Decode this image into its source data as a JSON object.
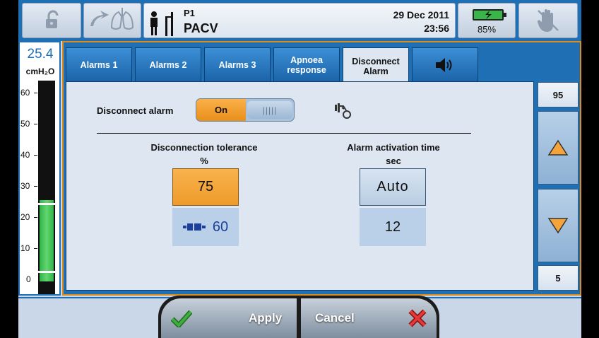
{
  "header": {
    "patient_id": "P1",
    "mode": "PACV",
    "date": "29 Dec 2011",
    "time": "23:56",
    "battery_percent": "85%",
    "battery_level": 1.0,
    "icons": [
      "unlock-icon",
      "lung-icon",
      "patient-icon",
      "battery-icon",
      "hand-icon"
    ]
  },
  "gauge": {
    "value": "25.4",
    "unit": "cmH₂O",
    "ticks": [
      "60",
      "50",
      "40",
      "30",
      "20",
      "10",
      "0"
    ],
    "fill_level_cmH2O": 25,
    "upper_mark_cmH2O": 24,
    "lower_mark_cmH2O": 3
  },
  "tabs": [
    {
      "label": "Alarms 1"
    },
    {
      "label": "Alarms 2"
    },
    {
      "label": "Alarms 3"
    },
    {
      "label": "Apnoea response"
    },
    {
      "label": "Disconnect Alarm"
    },
    {
      "label": "",
      "icon": "speaker-icon"
    }
  ],
  "active_tab": 4,
  "disconnect": {
    "label": "Disconnect alarm",
    "toggle_on": "On",
    "toggle_grip": "|||||"
  },
  "tolerance": {
    "title": "Disconnection tolerance",
    "unit": "%",
    "setting": "75",
    "measured": "60"
  },
  "activation": {
    "title": "Alarm activation time",
    "unit": "sec",
    "setting": "Auto",
    "measured": "12"
  },
  "side": {
    "max": "95",
    "min": "5"
  },
  "buttons": {
    "apply": "Apply",
    "cancel": "Cancel"
  },
  "colors": {
    "accent_blue": "#1f6fb5",
    "highlight_orange": "#f4a43a",
    "gauge_green": "#3cbf4e",
    "apply_check": "#3fae3f",
    "cancel_x": "#e23a3a"
  }
}
